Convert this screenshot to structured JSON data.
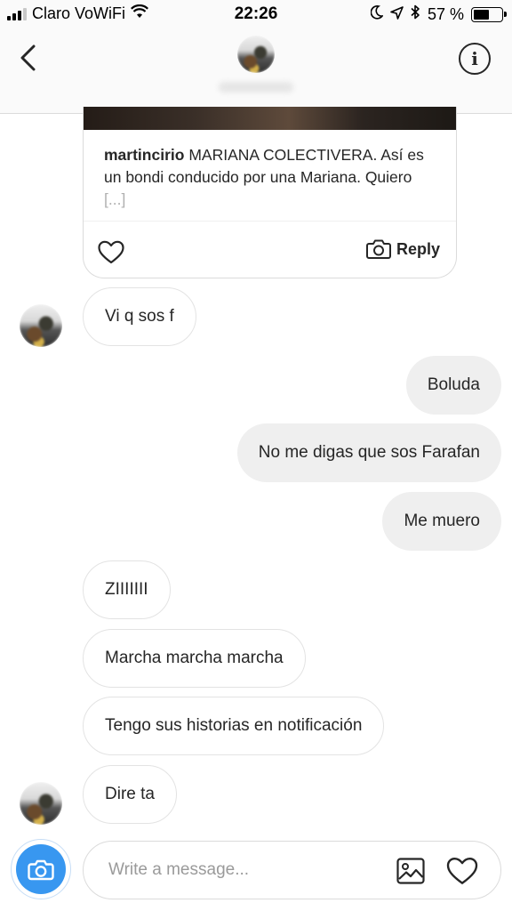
{
  "status_bar": {
    "carrier": "Claro VoWiFi",
    "time": "22:26",
    "battery_percent": "57 %",
    "battery_level": 0.57,
    "icons": [
      "signal-icon",
      "wifi-icon",
      "moon-icon",
      "location-arrow-icon",
      "bluetooth-icon",
      "battery-icon"
    ]
  },
  "header": {
    "back_icon": "chevron-left-icon",
    "info_icon": "info-icon",
    "info_glyph": "i"
  },
  "shared_post": {
    "username": "martincirio",
    "caption": " MARIANA COLECTIVERA. Así es un bondi conducido por una Mariana. Quiero ",
    "more": "[...]",
    "like_icon": "heart-outline-icon",
    "reply_icon": "camera-outline-icon",
    "reply_label": "Reply"
  },
  "messages": [
    {
      "text": "Vi q sos f",
      "direction": "in",
      "avatar": true
    },
    {
      "text": "Boluda",
      "direction": "out"
    },
    {
      "text": "No me digas que sos Farafan",
      "direction": "out"
    },
    {
      "text": "Me muero",
      "direction": "out"
    },
    {
      "text": "ZIIIIIII",
      "direction": "in"
    },
    {
      "text": "Marcha marcha marcha",
      "direction": "in"
    },
    {
      "text": "Tengo sus historias en notificación",
      "direction": "in"
    },
    {
      "text": "Dire ta",
      "direction": "in",
      "avatar": true
    }
  ],
  "composer": {
    "camera_icon": "camera-icon",
    "placeholder": "Write a message...",
    "gallery_icon": "image-icon",
    "heart_icon": "heart-outline-icon"
  },
  "colors": {
    "accent": "#3897f0",
    "outgoing_bubble": "#efefef",
    "incoming_border": "#e3e3e3",
    "text": "#262626"
  }
}
